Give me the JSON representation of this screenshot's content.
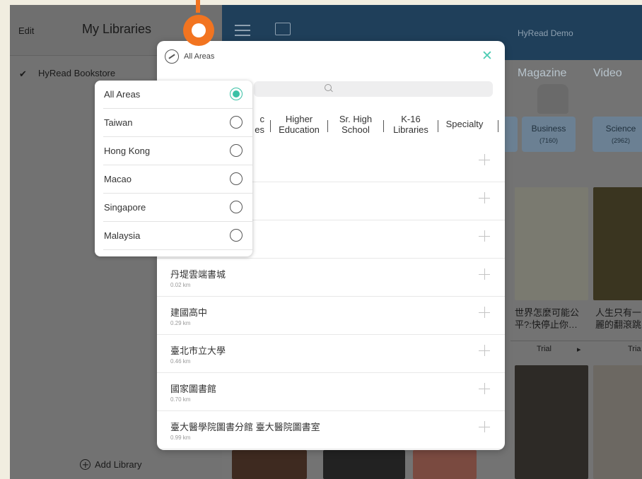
{
  "sidebar": {
    "edit_label": "Edit",
    "title": "My Libraries",
    "check_mark": "✔",
    "current_library": "HyRead Bookstore",
    "add_library_label": "Add Library"
  },
  "header": {
    "brand": "HyRead Demo",
    "tabs": [
      "Magazine",
      "Video"
    ]
  },
  "categories": [
    {
      "name": "Business",
      "count": "(7160)"
    },
    {
      "name": "Science",
      "count": "(2962)"
    }
  ],
  "books": [
    {
      "title": "世界怎麼可能公平?:快停止你…",
      "action": "Trial",
      "arrow": "▸"
    },
    {
      "title": "人生只有一麗的翻滾跳",
      "action": "Tria"
    }
  ],
  "popover": {
    "area_label": "All Areas",
    "close_glyph": "✕",
    "segments": [
      {
        "line1": "c",
        "line2": "es"
      },
      {
        "line1": "Higher",
        "line2": "Education"
      },
      {
        "line1": "Sr. High",
        "line2": "School"
      },
      {
        "line1": "K-16",
        "line2": "Libraries"
      },
      {
        "line1": "Specialty",
        "line2": ""
      }
    ],
    "locations": [
      {
        "name": "",
        "distance": ""
      },
      {
        "name": "",
        "distance": ""
      },
      {
        "name": "",
        "distance": ""
      },
      {
        "name": "丹堤雲端書城",
        "distance": "0.02 km"
      },
      {
        "name": "建國高中",
        "distance": "0.29 km"
      },
      {
        "name": "臺北市立大學",
        "distance": "0.46 km"
      },
      {
        "name": "國家圖書館",
        "distance": "0.70 km"
      },
      {
        "name": "臺大醫學院圖書分館 臺大醫院圖書室",
        "distance": "0.99 km"
      }
    ]
  },
  "area_dropdown": {
    "selected": "All Areas",
    "options": [
      "All Areas",
      "Taiwan",
      "Hong Kong",
      "Macao",
      "Singapore",
      "Malaysia"
    ]
  },
  "colors": {
    "accent": "#3ac1a5",
    "tap_indicator": "#f27420",
    "header_bg": "#1f3f5a"
  }
}
